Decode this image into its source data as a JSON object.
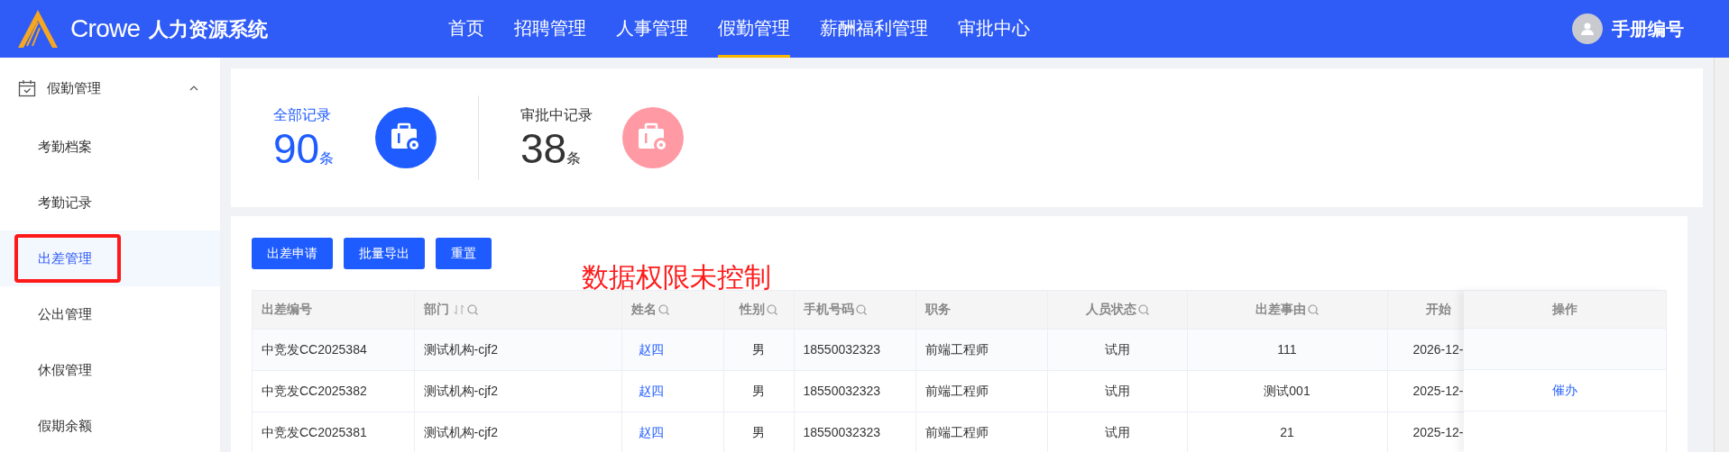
{
  "header": {
    "brand": "Crowe",
    "system_name": "人力资源系统",
    "nav": [
      {
        "label": "首页",
        "selected": false
      },
      {
        "label": "招聘管理",
        "selected": false
      },
      {
        "label": "人事管理",
        "selected": false
      },
      {
        "label": "假勤管理",
        "selected": true
      },
      {
        "label": "薪酬福利管理",
        "selected": false
      },
      {
        "label": "审批中心",
        "selected": false
      }
    ],
    "user": "手册编号"
  },
  "sidebar": {
    "group": {
      "label": "假勤管理",
      "expanded": true,
      "items": [
        {
          "label": "考勤档案",
          "selected": false,
          "highlighted": false
        },
        {
          "label": "考勤记录",
          "selected": false,
          "highlighted": false
        },
        {
          "label": "出差管理",
          "selected": true,
          "highlighted": true
        },
        {
          "label": "公出管理",
          "selected": false,
          "highlighted": false
        },
        {
          "label": "休假管理",
          "selected": false,
          "highlighted": false
        },
        {
          "label": "假期余额",
          "selected": false,
          "highlighted": false
        }
      ]
    }
  },
  "stats": [
    {
      "label": "全部记录",
      "value": "90",
      "unit": "条",
      "color": "#1f5cff"
    },
    {
      "label": "审批中记录",
      "value": "38",
      "unit": "条",
      "color": "#ff9aa5"
    }
  ],
  "toolbar": {
    "buttons": [
      "出差申请",
      "批量导出",
      "重置"
    ]
  },
  "annotation": "数据权限未控制",
  "table": {
    "columns": [
      {
        "label": "出差编号",
        "sortable": false,
        "searchable": false
      },
      {
        "label": "部门",
        "sortable": true,
        "searchable": true
      },
      {
        "label": "姓名",
        "sortable": false,
        "searchable": true
      },
      {
        "label": "性别",
        "sortable": false,
        "searchable": true
      },
      {
        "label": "手机号码",
        "sortable": false,
        "searchable": true
      },
      {
        "label": "职务",
        "sortable": false,
        "searchable": false
      },
      {
        "label": "人员状态",
        "sortable": false,
        "searchable": true
      },
      {
        "label": "出差事由",
        "sortable": false,
        "searchable": true
      },
      {
        "label": "开始",
        "sortable": false,
        "searchable": false
      }
    ],
    "action_column": "操作",
    "rows": [
      {
        "cells": [
          "中竞发CC2025384",
          "测试机构-cjf2",
          "赵四",
          "男",
          "18550032323",
          "前端工程师",
          "试用",
          "111",
          "2026-12-"
        ]
      },
      {
        "cells": [
          "中竞发CC2025382",
          "测试机构-cjf2",
          "赵四",
          "男",
          "18550032323",
          "前端工程师",
          "试用",
          "测试001",
          "2025-12-"
        ],
        "action": "催办"
      },
      {
        "cells": [
          "中竞发CC2025381",
          "测试机构-cjf2",
          "赵四",
          "男",
          "18550032323",
          "前端工程师",
          "试用",
          "21",
          "2025-12-"
        ]
      }
    ]
  }
}
